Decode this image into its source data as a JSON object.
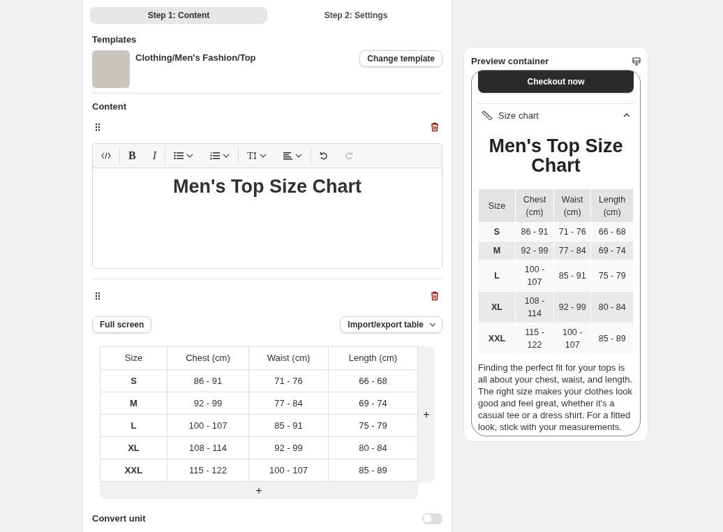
{
  "tabs": [
    {
      "label": "Step 1: Content",
      "selected": true
    },
    {
      "label": "Step 2: Settings",
      "selected": false
    }
  ],
  "templates": {
    "heading": "Templates",
    "name": "Clothing/Men's Fashion/Top",
    "button": "Change template"
  },
  "content": {
    "heading": "Content",
    "toolbar": [
      {
        "kind": "code",
        "disabled": false
      },
      {
        "kind": "bold",
        "glyph": "B",
        "disabled": false
      },
      {
        "kind": "italic",
        "glyph": "I",
        "disabled": false
      },
      {
        "kind": "bullets",
        "disabled": false
      },
      {
        "kind": "numbers",
        "disabled": false
      },
      {
        "kind": "size",
        "glyph": "T",
        "disabled": false
      },
      {
        "kind": "align",
        "disabled": false
      },
      {
        "kind": "undo",
        "disabled": false
      },
      {
        "kind": "redo",
        "disabled": true
      }
    ],
    "editor_text": "Men's Top Size Chart",
    "full_screen_button": "Full screen",
    "import_button": "Import/export table",
    "table": {
      "columns": [
        "Size",
        "Chest (cm)",
        "Waist (cm)",
        "Length (cm)"
      ],
      "rows": [
        [
          "S",
          "86 - 91",
          "71 - 76",
          "66 - 68"
        ],
        [
          "M",
          "92 - 99",
          "77 - 84",
          "69 - 74"
        ],
        [
          "L",
          "100 - 107",
          "85 - 91",
          "75 - 79"
        ],
        [
          "XL",
          "108 - 114",
          "92 - 99",
          "80 - 84"
        ],
        [
          "XXL",
          "115 - 122",
          "100 - 107",
          "85 - 89"
        ]
      ],
      "add_column": "+",
      "add_row": "+"
    },
    "convert_unit": {
      "label": "Convert unit",
      "on": false
    }
  },
  "preview": {
    "title": "Preview container",
    "checkout_button": "Checkout now",
    "accordion": {
      "label": "Size chart",
      "expanded": true
    },
    "chart_title": "Men's Top Size Chart",
    "table": {
      "columns": [
        "Size",
        "Chest (cm)",
        "Waist (cm)",
        "Length (cm)"
      ],
      "rows": [
        [
          "S",
          "86 - 91",
          "71 - 76",
          "66 - 68"
        ],
        [
          "M",
          "92 - 99",
          "77 - 84",
          "69 - 74"
        ],
        [
          "L",
          "100 - 107",
          "85 - 91",
          "75 - 79"
        ],
        [
          "XL",
          "108 - 114",
          "92 - 99",
          "80 - 84"
        ],
        [
          "XXL",
          "115 - 122",
          "100 - 107",
          "85 - 89"
        ]
      ]
    },
    "description": "Finding the perfect fit for your tops is all about your chest, waist, and length. The right size makes your clothes look good and feel great, whether it's a casual tee or a dress shirt. For a fitted look, stick with your measurements."
  }
}
